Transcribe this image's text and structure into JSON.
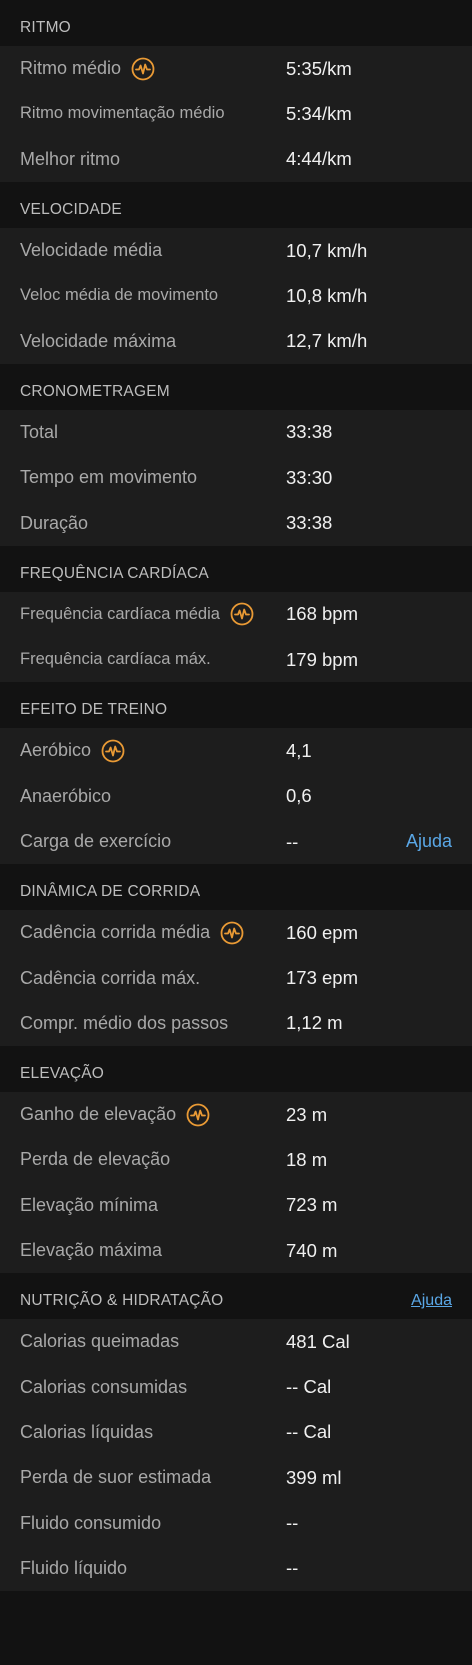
{
  "colors": {
    "accent": "#5aa7e6",
    "pr_icon": "#e99a35",
    "tab_indicator": "#3a8fd8"
  },
  "sections": [
    {
      "title": "RITMO",
      "rows": [
        {
          "label": "Ritmo médio",
          "value": "5:35/km",
          "icon": "performance-icon"
        },
        {
          "label": "Ritmo movimentação médio",
          "value": "5:34/km",
          "small": true
        },
        {
          "label": "Melhor ritmo",
          "value": "4:44/km"
        }
      ]
    },
    {
      "title": "VELOCIDADE",
      "rows": [
        {
          "label": "Velocidade média",
          "value": "10,7 km/h"
        },
        {
          "label": "Veloc média de movimento",
          "value": "10,8 km/h",
          "small": true
        },
        {
          "label": "Velocidade máxima",
          "value": "12,7 km/h"
        }
      ]
    },
    {
      "title": "CRONOMETRAGEM",
      "rows": [
        {
          "label": "Total",
          "value": "33:38"
        },
        {
          "label": "Tempo em movimento",
          "value": "33:30"
        },
        {
          "label": "Duração",
          "value": "33:38"
        }
      ]
    },
    {
      "title": "FREQUÊNCIA CARDÍACA",
      "rows": [
        {
          "label": "Frequência cardíaca média",
          "value": "168 bpm",
          "icon": "performance-icon",
          "small": true
        },
        {
          "label": "Frequência cardíaca máx.",
          "value": "179 bpm",
          "small": true
        }
      ]
    },
    {
      "title": "EFEITO DE TREINO",
      "rows": [
        {
          "label": "Aeróbico",
          "value": "4,1",
          "icon": "performance-icon"
        },
        {
          "label": "Anaeróbico",
          "value": "0,6"
        },
        {
          "label": "Carga de exercício",
          "value": "--",
          "help": "Ajuda"
        }
      ]
    },
    {
      "title": "DINÂMICA DE CORRIDA",
      "rows": [
        {
          "label": "Cadência corrida média",
          "value": "160 epm",
          "icon": "performance-icon"
        },
        {
          "label": "Cadência corrida máx.",
          "value": "173 epm"
        },
        {
          "label": "Compr. médio dos passos",
          "value": "1,12 m"
        }
      ]
    },
    {
      "title": "ELEVAÇÃO",
      "rows": [
        {
          "label": "Ganho de elevação",
          "value": "23 m",
          "icon": "performance-icon"
        },
        {
          "label": "Perda de elevação",
          "value": "18 m"
        },
        {
          "label": "Elevação mínima",
          "value": "723 m"
        },
        {
          "label": "Elevação máxima",
          "value": "740 m"
        }
      ]
    },
    {
      "title": "NUTRIÇÃO & HIDRATAÇÃO",
      "help": "Ajuda",
      "rows": [
        {
          "label": "Calorias queimadas",
          "value": "481 Cal"
        },
        {
          "label": "Calorias consumidas",
          "value": "-- Cal"
        },
        {
          "label": "Calorias líquidas",
          "value": "-- Cal"
        },
        {
          "label": "Perda de suor estimada",
          "value": "399 ml"
        },
        {
          "label": "Fluido consumido",
          "value": "--"
        },
        {
          "label": "Fluido líquido",
          "value": "--"
        }
      ]
    }
  ]
}
